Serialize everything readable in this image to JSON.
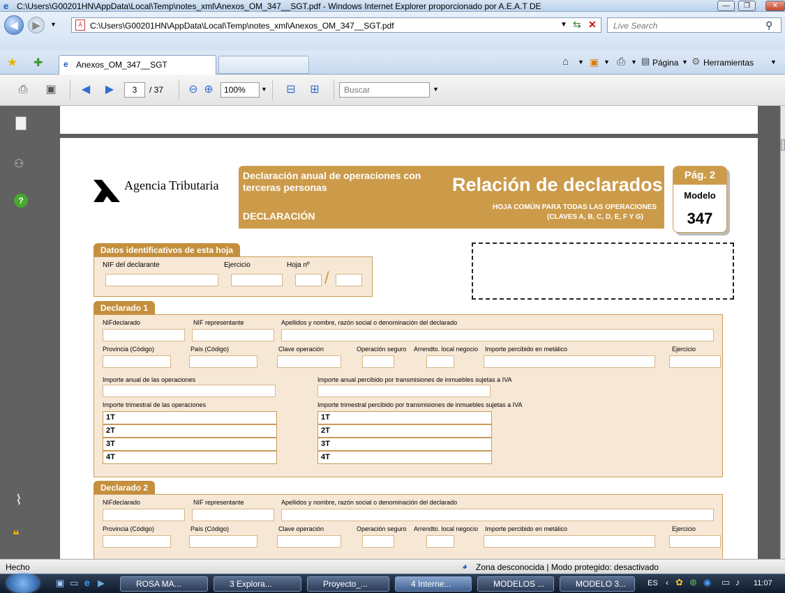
{
  "window": {
    "title": "C:\\Users\\G00201HN\\AppData\\Local\\Temp\\notes_xml\\Anexos_OM_347__SGT.pdf - Windows Internet Explorer proporcionado por A.E.A.T DE",
    "controls": {
      "minimize": "—",
      "maximize": "❐",
      "close": "✕"
    }
  },
  "addressbar": {
    "url": "C:\\Users\\G00201HN\\AppData\\Local\\Temp\\notes_xml\\Anexos_OM_347__SGT.pdf",
    "search_placeholder": "Live Search"
  },
  "tabs": {
    "active_label": "Anexos_OM_347__SGT",
    "commands": {
      "page": "Página",
      "tools": "Herramientas"
    }
  },
  "pdf_toolbar": {
    "page_current": "3",
    "page_total": "/ 37",
    "zoom": "100%",
    "search_placeholder": "Buscar"
  },
  "form": {
    "logo_text": "Agencia Tributaria",
    "header_title": "Declaración anual de operaciones con terceras personas",
    "header_sub": "DECLARACIÓN",
    "relacion_title": "Relación de declarados",
    "relacion_note1": "HOJA COMÚN PARA TODAS LAS OPERACIONES",
    "relacion_note2": "(CLAVES A, B, C, D, E, F Y G)",
    "pag_label": "Pág. 2",
    "modelo_label": "Modelo",
    "modelo_number": "347",
    "datos": {
      "title": "Datos identificativos de esta hoja",
      "nif_label": "NIF del declarante",
      "ejercicio_label": "Ejercicio",
      "hoja_label": "Hoja nº",
      "slash": "/"
    },
    "declarado1": {
      "title": "Declarado 1",
      "nif": "NIFdeclarado",
      "nif_rep": "NIF representante",
      "apellidos": "Apellidos y nombre, razón social o denominación del declarado",
      "provincia": "Provincia (Código)",
      "pais": "País (Código)",
      "clave": "Clave operación",
      "seguro": "Operación seguro",
      "arrend": "Arrendto. local negocio",
      "importe_metalico": "Importe percibido en metálico",
      "ejercicio": "Ejercicio",
      "importe_anual": "Importe anual de las operaciones",
      "importe_anual_iva": "Importe anual percibido por transmisiones de inmuebles sujetas a IVA",
      "importe_trimestral": "Importe trimestral de las operaciones",
      "importe_trimestral_iva": "Importe trimestral percibido por transmisiones de inmuebles sujetas a IVA",
      "quarters": [
        "1T",
        "2T",
        "3T",
        "4T"
      ]
    },
    "declarado2": {
      "title": "Declarado 2",
      "nif": "NIFdeclarado",
      "nif_rep": "NIF representante",
      "apellidos": "Apellidos y nombre, razón social o denominación del declarado",
      "provincia": "Provincia (Código)",
      "pais": "País (Código)",
      "clave": "Clave operación",
      "seguro": "Operación seguro",
      "arrend": "Arrendto. local negocio",
      "importe_metalico": "Importe percibido en metálico",
      "ejercicio": "Ejercicio"
    }
  },
  "statusbar": {
    "left": "Hecho",
    "zone": "Zona desconocida | Modo protegido: desactivado"
  },
  "taskbar": {
    "buttons": [
      "ROSA MA...",
      "3 Explora...",
      "Proyecto_...",
      "4 Interne...",
      "MODELOS ...",
      "MODELO 3..."
    ],
    "lang": "ES",
    "time": "11:07"
  }
}
